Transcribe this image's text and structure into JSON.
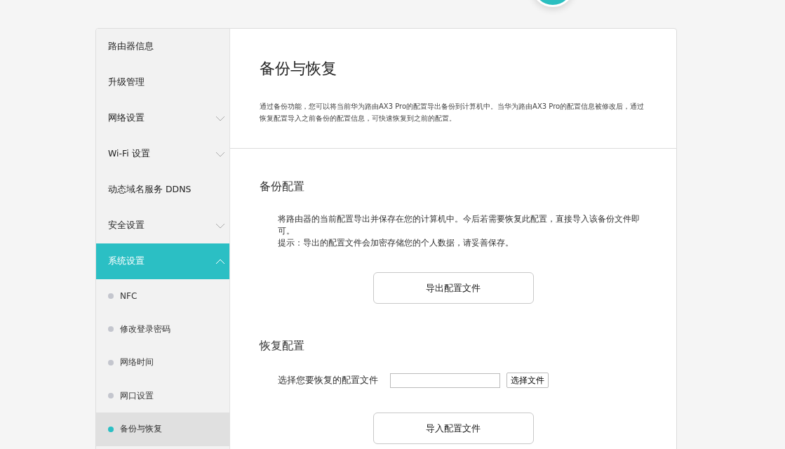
{
  "sidebar": {
    "items": [
      {
        "kind": "link",
        "label": "路由器信息",
        "selected": false
      },
      {
        "kind": "link",
        "label": "升级管理",
        "selected": false
      },
      {
        "kind": "group",
        "label": "网络设置",
        "selected": false,
        "expanded": false
      },
      {
        "kind": "group",
        "label": "Wi-Fi 设置",
        "selected": false,
        "expanded": false
      },
      {
        "kind": "link",
        "label": "动态域名服务 DDNS",
        "selected": false
      },
      {
        "kind": "group",
        "label": "安全设置",
        "selected": false,
        "expanded": false
      },
      {
        "kind": "group",
        "label": "系统设置",
        "selected": true,
        "expanded": true,
        "children": [
          {
            "label": "NFC",
            "selected": false
          },
          {
            "label": "修改登录密码",
            "selected": false
          },
          {
            "label": "网络时间",
            "selected": false
          },
          {
            "label": "网口设置",
            "selected": false
          },
          {
            "label": "备份与恢复",
            "selected": true
          }
        ]
      }
    ]
  },
  "page": {
    "title": "备份与恢复",
    "description": "通过备份功能，您可以将当前华为路由AX3 Pro的配置导出备份到计算机中。当华为路由AX3 Pro的配置信息被修改后，通过恢复配置导入之前备份的配置信息，可快速恢复到之前的配置。"
  },
  "backup": {
    "heading": "备份配置",
    "text": "将路由器的当前配置导出并保存在您的计算机中。今后若需要恢复此配置，直接导入该备份文件即可。",
    "hint": "提示：导出的配置文件会加密存储您的个人数据，请妥善保存。",
    "button": "导出配置文件"
  },
  "restore": {
    "heading": "恢复配置",
    "file_label": "选择您要恢复的配置文件",
    "choose_button": "选择文件",
    "button": "导入配置文件"
  }
}
